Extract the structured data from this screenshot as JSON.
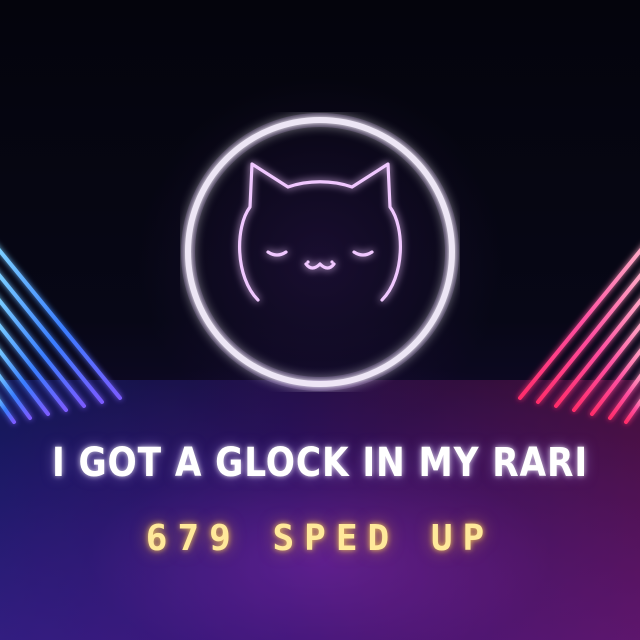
{
  "cover": {
    "title": "I GOT A GLOCK IN MY RARI",
    "subtitle": "679 SPED UP",
    "emblem_icon": "cat-face-icon",
    "colors": {
      "background": "#05050f",
      "ring_glow": "#ffffff",
      "cat_outline": "#e9b8ff",
      "left_lines": "#3a7dff",
      "right_lines": "#ff4fa0",
      "subtitle": "#ffe99a",
      "title": "#ffffff"
    }
  }
}
